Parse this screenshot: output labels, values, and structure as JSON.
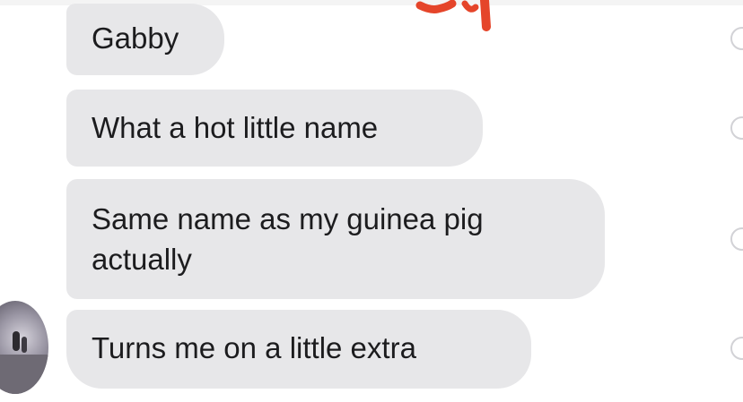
{
  "conversation": {
    "messages": [
      {
        "text": "Gabby"
      },
      {
        "text": "What a hot little name"
      },
      {
        "text": "Same name as my guinea pig actually"
      },
      {
        "text": "Turns me on a little extra"
      }
    ]
  },
  "colors": {
    "bubble_background": "#e7e7e9",
    "text": "#1c1c1e",
    "scribble": "#e5452a"
  },
  "icons": {
    "avatar": "contact-avatar-photo",
    "receipt": "read-receipt-circle-icon",
    "scribble": "red-marker-scribble"
  }
}
